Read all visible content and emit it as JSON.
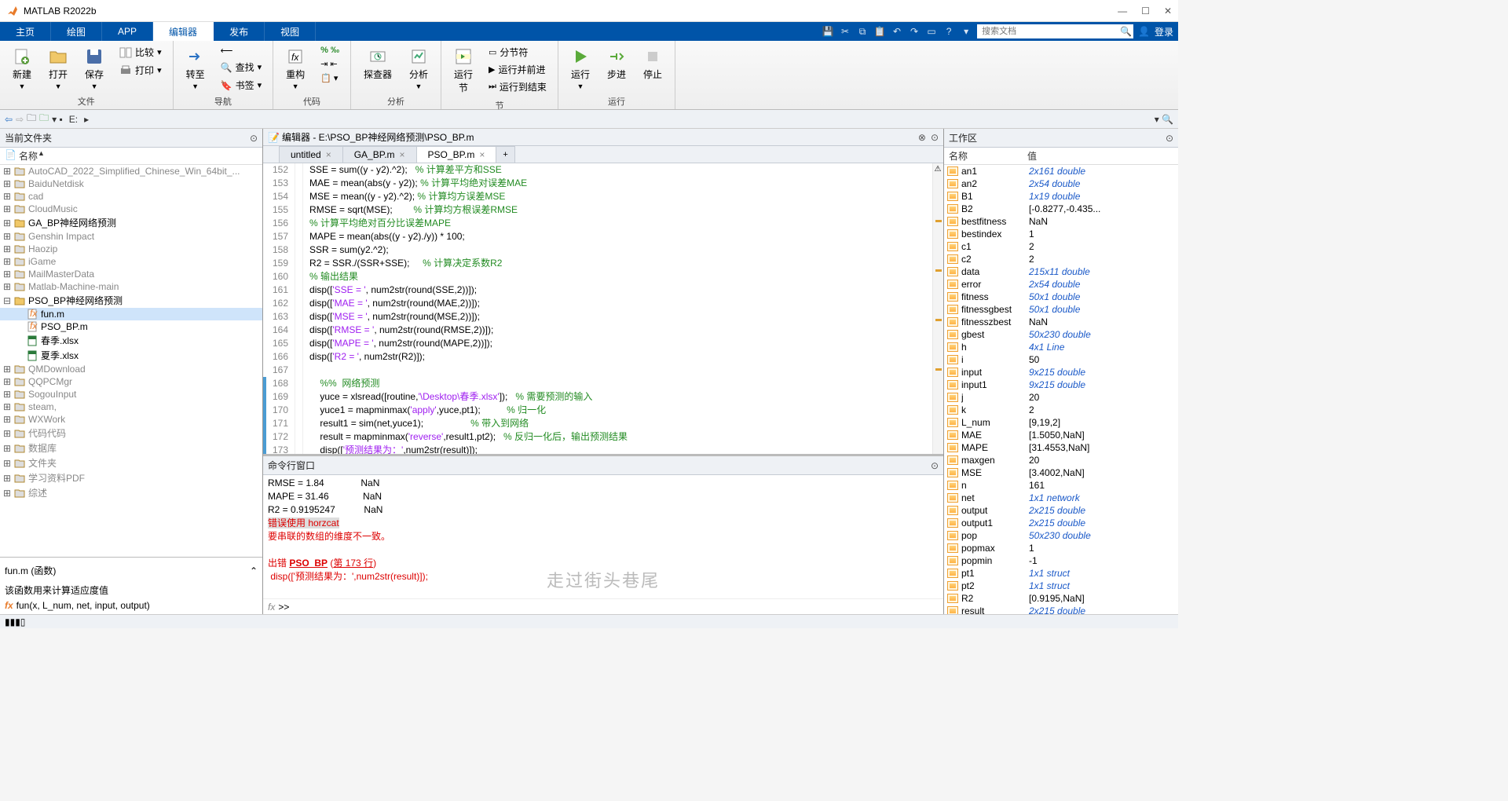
{
  "title": "MATLAB R2022b",
  "menutabs": [
    "主页",
    "绘图",
    "APP",
    "编辑器",
    "发布",
    "视图"
  ],
  "active_menu": 3,
  "search_placeholder": "搜索文档",
  "login": "登录",
  "toolbar": {
    "file": {
      "new": "新建",
      "open": "打开",
      "save": "保存",
      "compare": "比较",
      "print": "打印",
      "label": "文件"
    },
    "nav": {
      "goto": "转至",
      "find": "查找",
      "bookmark": "书签",
      "label": "导航"
    },
    "refactor": {
      "refactor": "重构",
      "label": "代码"
    },
    "analyze": {
      "analyzer": "探查器",
      "analyze": "分析",
      "label": "分析"
    },
    "section": {
      "runsec": "运行\n节",
      "split": "分节符",
      "runadv": "运行并前进",
      "runend": "运行到结束",
      "label": "节"
    },
    "run": {
      "run": "运行",
      "step": "步进",
      "stop": "停止",
      "label": "运行"
    }
  },
  "path": [
    "E:"
  ],
  "left": {
    "title": "当前文件夹",
    "col": "名称",
    "tree": [
      {
        "t": "folder",
        "n": "AutoCAD_2022_Simplified_Chinese_Win_64bit_..."
      },
      {
        "t": "folder",
        "n": "BaiduNetdisk"
      },
      {
        "t": "folder",
        "n": "cad"
      },
      {
        "t": "folder",
        "n": "CloudMusic"
      },
      {
        "t": "folder",
        "n": "GA_BP神经网络预测",
        "hl": true
      },
      {
        "t": "folder",
        "n": "Genshin Impact"
      },
      {
        "t": "folder",
        "n": "Haozip"
      },
      {
        "t": "folder",
        "n": "iGame"
      },
      {
        "t": "folder",
        "n": "MailMasterData"
      },
      {
        "t": "folder",
        "n": "Matlab-Machine-main"
      },
      {
        "t": "folder",
        "n": "PSO_BP神经网络预测",
        "exp": true,
        "children": [
          {
            "t": "m",
            "n": "fun.m",
            "sel": true
          },
          {
            "t": "m",
            "n": "PSO_BP.m"
          },
          {
            "t": "xlsx",
            "n": "春季.xlsx"
          },
          {
            "t": "xlsx",
            "n": "夏季.xlsx"
          }
        ]
      },
      {
        "t": "folder",
        "n": "QMDownload"
      },
      {
        "t": "folder",
        "n": "QQPCMgr"
      },
      {
        "t": "folder",
        "n": "SogouInput"
      },
      {
        "t": "folder",
        "n": "steam,"
      },
      {
        "t": "folder",
        "n": "WXWork"
      },
      {
        "t": "folder",
        "n": "代码代码"
      },
      {
        "t": "folder",
        "n": "数据库"
      },
      {
        "t": "folder",
        "n": "文件夹"
      },
      {
        "t": "folder",
        "n": "学习资料PDF"
      },
      {
        "t": "folder",
        "n": "综述"
      }
    ],
    "details_title": "fun.m (函数)",
    "details_desc": "该函数用来计算适应度值",
    "details_sig": "fun(x, L_num, net, input, output)"
  },
  "editor": {
    "title": "编辑器 - E:\\PSO_BP神经网络预测\\PSO_BP.m",
    "tabs": [
      "untitled",
      "GA_BP.m",
      "PSO_BP.m"
    ],
    "active_tab": 2,
    "first_line": 152,
    "lines": [
      [
        [
          "",
          "SSE = sum((y - y2).^2);   "
        ],
        [
          "cmt",
          "% 计算差平方和SSE"
        ]
      ],
      [
        [
          "",
          "MAE = mean(abs(y - y2)); "
        ],
        [
          "cmt",
          "% 计算平均绝对误差MAE"
        ]
      ],
      [
        [
          "",
          "MSE = mean((y - y2).^2); "
        ],
        [
          "cmt",
          "% 计算均方误差MSE"
        ]
      ],
      [
        [
          "",
          "RMSE = sqrt(MSE);        "
        ],
        [
          "cmt",
          "% 计算均方根误差RMSE"
        ]
      ],
      [
        [
          "cmt",
          "% 计算平均绝对百分比误差MAPE"
        ]
      ],
      [
        [
          "",
          "MAPE = mean(abs((y - y2)./y)) * 100;"
        ]
      ],
      [
        [
          "",
          "SSR = sum(y2.^2);"
        ]
      ],
      [
        [
          "",
          "R2 = SSR./(SSR+SSE);     "
        ],
        [
          "cmt",
          "% 计算决定系数R2"
        ]
      ],
      [
        [
          "cmt",
          "% 输出结果"
        ]
      ],
      [
        [
          "",
          "disp(["
        ],
        [
          "str",
          "'SSE = '"
        ],
        [
          "",
          ", num2str(round(SSE,2))]);"
        ]
      ],
      [
        [
          "",
          "disp(["
        ],
        [
          "str",
          "'MAE = '"
        ],
        [
          "",
          ", num2str(round(MAE,2))]);"
        ]
      ],
      [
        [
          "",
          "disp(["
        ],
        [
          "str",
          "'MSE = '"
        ],
        [
          "",
          ", num2str(round(MSE,2))]);"
        ]
      ],
      [
        [
          "",
          "disp(["
        ],
        [
          "str",
          "'RMSE = '"
        ],
        [
          "",
          ", num2str(round(RMSE,2))]);"
        ]
      ],
      [
        [
          "",
          "disp(["
        ],
        [
          "str",
          "'MAPE = '"
        ],
        [
          "",
          ", num2str(round(MAPE,2))]);"
        ]
      ],
      [
        [
          "",
          "disp(["
        ],
        [
          "str",
          "'R2 = '"
        ],
        [
          "",
          ", num2str(R2)]);"
        ]
      ],
      [
        [
          "",
          ""
        ]
      ],
      [
        [
          "",
          "    "
        ],
        [
          "cmt",
          "%%  网络预测"
        ]
      ],
      [
        [
          "",
          "    yuce = xlsread([routine,"
        ],
        [
          "str",
          "'\\Desktop\\春季.xlsx'"
        ],
        [
          "",
          "]);   "
        ],
        [
          "cmt",
          "% 需要预测的输入"
        ]
      ],
      [
        [
          "",
          "    yuce1 = mapminmax("
        ],
        [
          "str",
          "'apply'"
        ],
        [
          "",
          ",yuce,pt1);          "
        ],
        [
          "cmt",
          "% 归一化"
        ]
      ],
      [
        [
          "",
          "    result1 = sim(net,yuce1);                  "
        ],
        [
          "cmt",
          "% 带入到网络"
        ]
      ],
      [
        [
          "",
          "    result = mapminmax("
        ],
        [
          "str",
          "'reverse'"
        ],
        [
          "",
          ",result1,pt2);   "
        ],
        [
          "cmt",
          "% 反归一化后，输出预测结果"
        ]
      ],
      [
        [
          "",
          "    disp(["
        ],
        [
          "str",
          "'预测结果为：'"
        ],
        [
          "",
          ",num2str(result)]);"
        ]
      ]
    ],
    "section_start": 16
  },
  "cmd": {
    "title": "命令行窗口",
    "lines": [
      {
        "txt": "RMSE = 1.84              NaN"
      },
      {
        "txt": "MAPE = 31.46             NaN"
      },
      {
        "txt": "R2 = 0.9195247           NaN"
      },
      {
        "txt": "错误使用 horzcat",
        "cls": "err",
        "hl": true
      },
      {
        "txt": "要串联的数组的维度不一致。",
        "cls": "err"
      },
      {
        "txt": ""
      },
      {
        "parts": [
          {
            "t": "出错 ",
            "c": "err"
          },
          {
            "t": "PSO_BP",
            "c": "err lnk",
            "b": true
          },
          {
            "t": " (",
            "c": "err"
          },
          {
            "t": "第 173 行",
            "c": "err lnk"
          },
          {
            "t": ")",
            "c": "err"
          }
        ]
      },
      {
        "txt": " disp(['预测结果为：',num2str(result)]);",
        "cls": "err"
      }
    ],
    "watermark": "走过街头巷尾",
    "prompt": ">> "
  },
  "ws": {
    "title": "工作区",
    "cols": [
      "名称",
      "值"
    ],
    "vars": [
      [
        "an1",
        "2x161 double",
        1
      ],
      [
        "an2",
        "2x54 double",
        1
      ],
      [
        "B1",
        "1x19 double",
        1
      ],
      [
        "B2",
        "[-0.8277,-0.435...",
        0
      ],
      [
        "bestfitness",
        "NaN",
        0
      ],
      [
        "bestindex",
        "1",
        0
      ],
      [
        "c1",
        "2",
        0
      ],
      [
        "c2",
        "2",
        0
      ],
      [
        "data",
        "215x11 double",
        1
      ],
      [
        "error",
        "2x54 double",
        1
      ],
      [
        "fitness",
        "50x1 double",
        1
      ],
      [
        "fitnessgbest",
        "50x1 double",
        1
      ],
      [
        "fitnesszbest",
        "NaN",
        0
      ],
      [
        "gbest",
        "50x230 double",
        1
      ],
      [
        "h",
        "4x1 Line",
        1
      ],
      [
        "i",
        "50",
        0
      ],
      [
        "input",
        "9x215 double",
        1
      ],
      [
        "input1",
        "9x215 double",
        1
      ],
      [
        "j",
        "20",
        0
      ],
      [
        "k",
        "2",
        0
      ],
      [
        "L_num",
        "[9,19,2]",
        0
      ],
      [
        "MAE",
        "[1.5050,NaN]",
        0
      ],
      [
        "MAPE",
        "[31.4553,NaN]",
        0
      ],
      [
        "maxgen",
        "20",
        0
      ],
      [
        "MSE",
        "[3.4002,NaN]",
        0
      ],
      [
        "n",
        "161",
        0
      ],
      [
        "net",
        "1x1 network",
        1
      ],
      [
        "output",
        "2x215 double",
        1
      ],
      [
        "output1",
        "2x215 double",
        1
      ],
      [
        "pop",
        "50x230 double",
        1
      ],
      [
        "popmax",
        "1",
        0
      ],
      [
        "popmin",
        "-1",
        0
      ],
      [
        "pt1",
        "1x1 struct",
        1
      ],
      [
        "pt2",
        "1x1 struct",
        1
      ],
      [
        "R2",
        "[0.9195,NaN]",
        0
      ],
      [
        "result",
        "2x215 double",
        1
      ]
    ]
  },
  "statusbar": ""
}
